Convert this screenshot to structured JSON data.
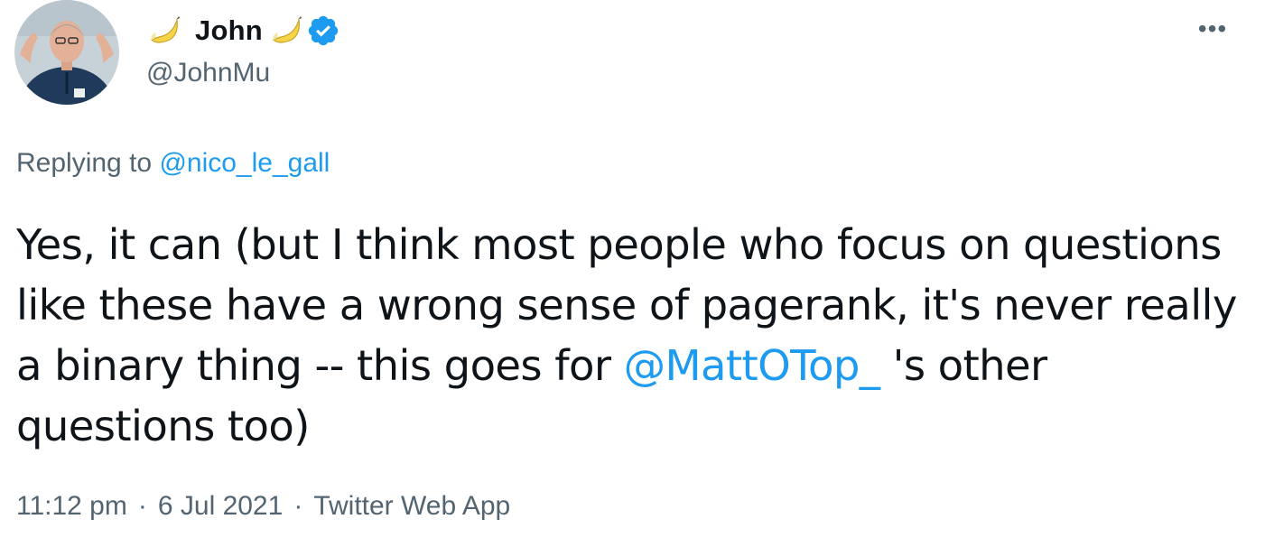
{
  "author": {
    "display_name": "John",
    "handle": "@JohnMu",
    "left_emoji": "banana-emoji",
    "right_emoji": "banana-emoji",
    "verified_icon": "verified-badge-icon",
    "verified_color": "#1d9bf0"
  },
  "more_menu": {
    "icon": "more-options-icon",
    "label": "•••"
  },
  "reply": {
    "prefix": "Replying to",
    "mention": "@nico_le_gall"
  },
  "tweet": {
    "text_before_mention": "Yes, it can (but I think most people who focus on questions like these have a wrong sense of pagerank, it's never really a binary thing -- this goes for ",
    "mention": "@MattOTop_",
    "text_after_mention": " 's other questions too)"
  },
  "meta": {
    "time": "11:12 pm",
    "date": "6 Jul 2021",
    "source": "Twitter Web App",
    "separator": "·"
  },
  "colors": {
    "link": "#1d9bf0",
    "secondary_text": "#536471",
    "primary_text": "#0f1419"
  }
}
